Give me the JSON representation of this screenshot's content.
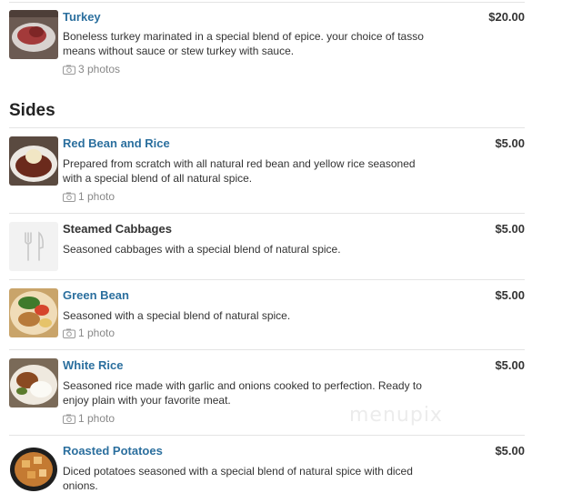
{
  "section": {
    "title": "Sides"
  },
  "watermark": "menupix",
  "items": [
    {
      "name": "Turkey",
      "price": "$20.00",
      "description": "Boneless turkey marinated in a special blend of epice. your choice of tasso means without sauce or stew turkey with sauce.",
      "photos": "3 photos"
    },
    {
      "name": "Red Bean and Rice",
      "price": "$5.00",
      "description": "Prepared from scratch with all natural red bean and yellow rice seasoned with a special blend of all natural spice.",
      "photos": "1 photo"
    },
    {
      "name": "Steamed Cabbages",
      "price": "$5.00",
      "description": "Seasoned cabbages with a special blend of natural spice."
    },
    {
      "name": "Green Bean",
      "price": "$5.00",
      "description": "Seasoned with a special blend of natural spice.",
      "photos": "1 photo"
    },
    {
      "name": "White Rice",
      "price": "$5.00",
      "description": "Seasoned rice made with garlic and onions cooked to perfection. Ready to enjoy plain with your favorite meat.",
      "photos": "1 photo"
    },
    {
      "name": "Roasted Potatoes",
      "price": "$5.00",
      "description": "Diced potatoes seasoned with a special blend of natural spice with diced onions."
    }
  ]
}
